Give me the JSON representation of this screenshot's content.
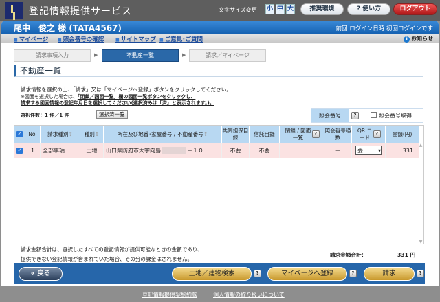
{
  "app": {
    "title": "登記情報提供サービス",
    "font_size_label": "文字サイズ変更",
    "sizes": [
      "小",
      "中",
      "大"
    ],
    "env": "推奨環境",
    "help": "? 使い方",
    "logout": "ログアウト"
  },
  "header": {
    "user": "尾中　俊之 様 (TATA4567)",
    "last_login": "前回 ログイン日時 初回ログインです"
  },
  "nav": {
    "items": [
      "マイページ",
      "照会番号の確認",
      "サイトマップ",
      "ご意見･ご質問"
    ],
    "notice": "お知らせ"
  },
  "steps": [
    "請求事項入力",
    "不動産一覧",
    "請求／マイページ"
  ],
  "page_title": "不動産一覧",
  "instructions": {
    "line1": "請求情報を選択の上、「請求」又は「マイページへ登録」ボタンをクリックしてください。",
    "line2_prefix": "※図面を選択した場合は、",
    "line2_bold": "「閉鎖／図面一覧」欄の図面一覧ボタンをクリックし、",
    "line3": "請求する図面情報の登記年月日を選択してください(選択済みは「済」と表示されます。)。"
  },
  "selection": {
    "count": "選択件数：1 件／1 件",
    "selected_list_button": "選択済一覧"
  },
  "inquiry": {
    "label": "照会番号",
    "help": "?",
    "checkbox_label": "照会番号取得"
  },
  "table": {
    "headers": [
      "No.",
      "請求種別",
      "種別",
      "所在及び地番･家屋番号 / 不動産番号",
      "共同担保目録",
      "信託目録",
      "閉鎖 / 図面一覧",
      "照会番号通数",
      "QR コード",
      "金額(円)"
    ],
    "rows": [
      {
        "no": "1",
        "type": "全部事項",
        "kind": "土地",
        "address": "山口県防府市大字向島",
        "address_suffix": "－１０",
        "joint": "不要",
        "trust": "不要",
        "closed": "",
        "inquiry_count": "－",
        "qr": "要",
        "amount": "331"
      }
    ]
  },
  "notes": {
    "line1": "請求金額合計は、選択したすべての登記情報が提供可能なときの金額であり、",
    "line2": "提供できない登記情報が含まれていた場合、その分の課金はされません。",
    "total_label": "請求金額合計：",
    "total_value": "331 円"
  },
  "buttons": {
    "back": "« 戻る",
    "search": "土地／建物検索",
    "register": "マイページへ登録",
    "request": "請求",
    "help": "?"
  },
  "footer": {
    "links": [
      "登記情報提供契約約款",
      "個人情報の取り扱いについて"
    ]
  }
}
